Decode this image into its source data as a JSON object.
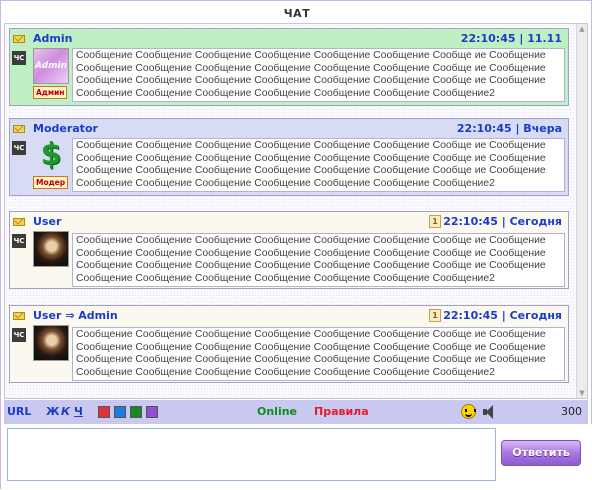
{
  "title": "ЧАТ",
  "messages": [
    {
      "kind": "admin",
      "username": "Admin",
      "timestamp": "22:10:45 | 11.11",
      "blacklist_label": "ЧС",
      "role_badge": "Админ",
      "avatar_caption": "Admin",
      "lines": [
        "Сообщение Сообщение Сообщение Сообщение Сообщение Сообщение Сообще ие Сообщение",
        "Сообщение Сообщение Сообщение Сообщение Сообщение Сообщение Сообще ие Сообщение",
        "Сообщение Сообщение Сообщение Сообщение Сообщение Сообщение Сообще ие Сообщение",
        "Сообщение Сообщение Сообщение Сообщение Сообщение Сообщение Сообщение2"
      ]
    },
    {
      "kind": "mod",
      "username": "Moderator",
      "timestamp": "22:10:45 | Вчера",
      "blacklist_label": "ЧС",
      "role_badge": "Модер",
      "avatar_glyph": "$",
      "lines": [
        "Сообщение Сообщение Сообщение Сообщение Сообщение Сообщение Сообще ие Сообщение",
        "Сообщение Сообщение Сообщение Сообщение Сообщение Сообщение Сообще ие Сообщение",
        "Сообщение Сообщение Сообщение Сообщение Сообщение Сообщение Сообще ие Сообщение",
        "Сообщение Сообщение Сообщение Сообщение Сообщение Сообщение Сообщение2"
      ]
    },
    {
      "kind": "user",
      "username": "User",
      "timestamp": "22:10:45 | Сегодня",
      "unread": "1",
      "blacklist_label": "ЧС",
      "lines": [
        "Сообщение Сообщение Сообщение Сообщение Сообщение Сообщение Сообще ие Сообщение",
        "Сообщение Сообщение Сообщение Сообщение Сообщение Сообщение Сообще ие Сообщение",
        "Сообщение Сообщение Сообщение Сообщение Сообщение Сообщение Сообще ие Сообщение",
        "Сообщение Сообщение Сообщение Сообщение Сообщение Сообщение Сообщение2"
      ]
    },
    {
      "kind": "user",
      "username": "User ⇒ Admin",
      "timestamp": "22:10:45 | Сегодня",
      "unread": "1",
      "blacklist_label": "ЧС",
      "lines": [
        "Сообщение Сообщение Сообщение Сообщение Сообщение Сообщение Сообще ие Сообщение",
        "Сообщение Сообщение Сообщение Сообщение Сообщение Сообщение Сообще ие Сообщение",
        "Сообщение Сообщение Сообщение Сообщение Сообщение Сообщение Сообще ие Сообщение",
        "Сообщение Сообщение Сообщение Сообщение Сообщение Сообщение Сообщение2"
      ]
    }
  ],
  "toolbar": {
    "url_label": "URL",
    "bold_label": "Ж",
    "italic_label": "К",
    "underline_label": "Ч",
    "colors": [
      "#e0303a",
      "#1e7ce0",
      "#1a8a22",
      "#8e4fd0"
    ],
    "online_label": "Online",
    "rules_label": "Правила",
    "char_count": "300",
    "smiley_icon": "smiley-icon",
    "sound_icon": "speaker-icon"
  },
  "input": {
    "value": "",
    "placeholder": ""
  },
  "send_button": {
    "label": "Ответить"
  }
}
